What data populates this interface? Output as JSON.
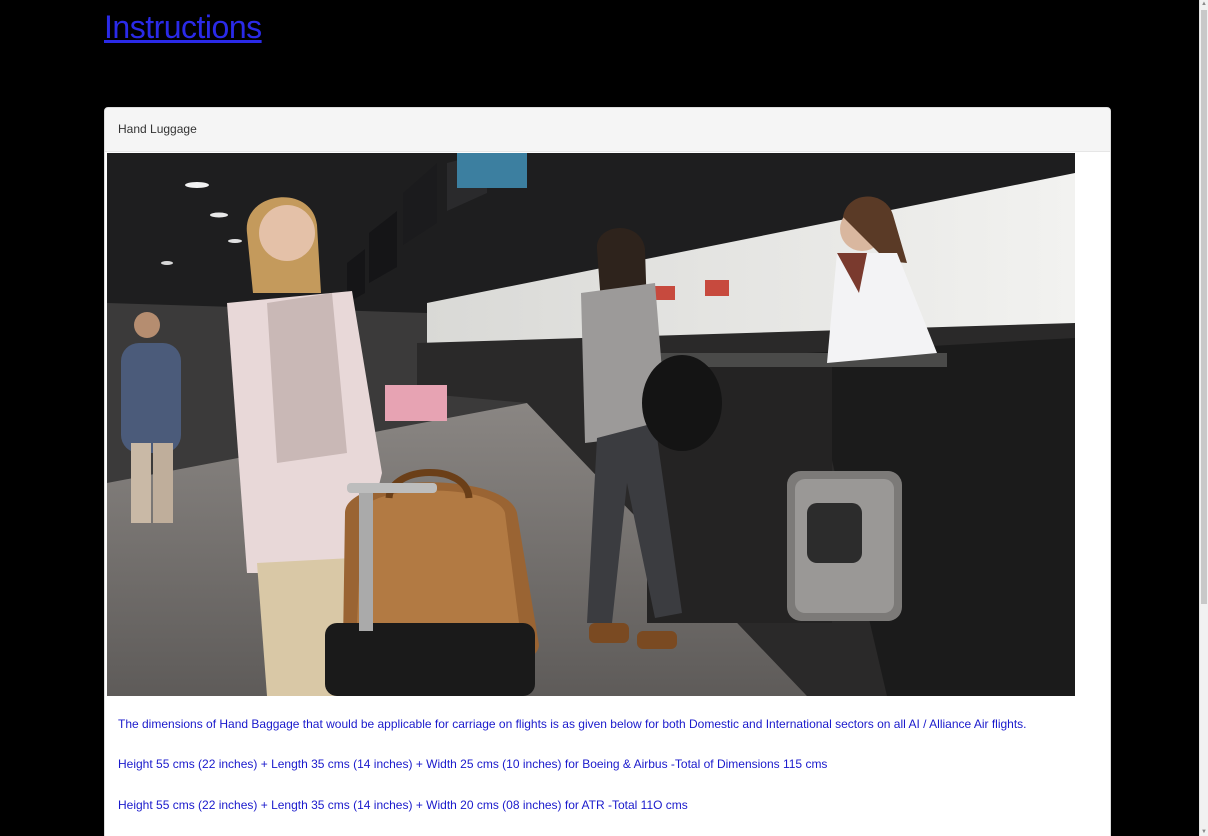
{
  "heading": {
    "title": "Instructions",
    "link_color": "#2a2ae8"
  },
  "panel": {
    "title": "Hand Luggage",
    "paragraphs": [
      "The dimensions of Hand Baggage that would be applicable for carriage on flights is as given below for both Domestic and International sectors on all AI / Alliance Air flights.",
      "Height 55 cms (22 inches) + Length 35 cms (14 inches) + Width 25 cms (10 inches) for Boeing & Airbus -Total of Dimensions 115 cms",
      "Height 55 cms (22 inches) + Length 35 cms (14 inches) + Width 20 cms (08 inches) for ATR -Total 11O cms"
    ],
    "text_color": "#1a1acc"
  },
  "scrollbar": {
    "up_icon": "scroll-up-arrow-icon",
    "down_icon": "scroll-down-arrow-icon"
  }
}
